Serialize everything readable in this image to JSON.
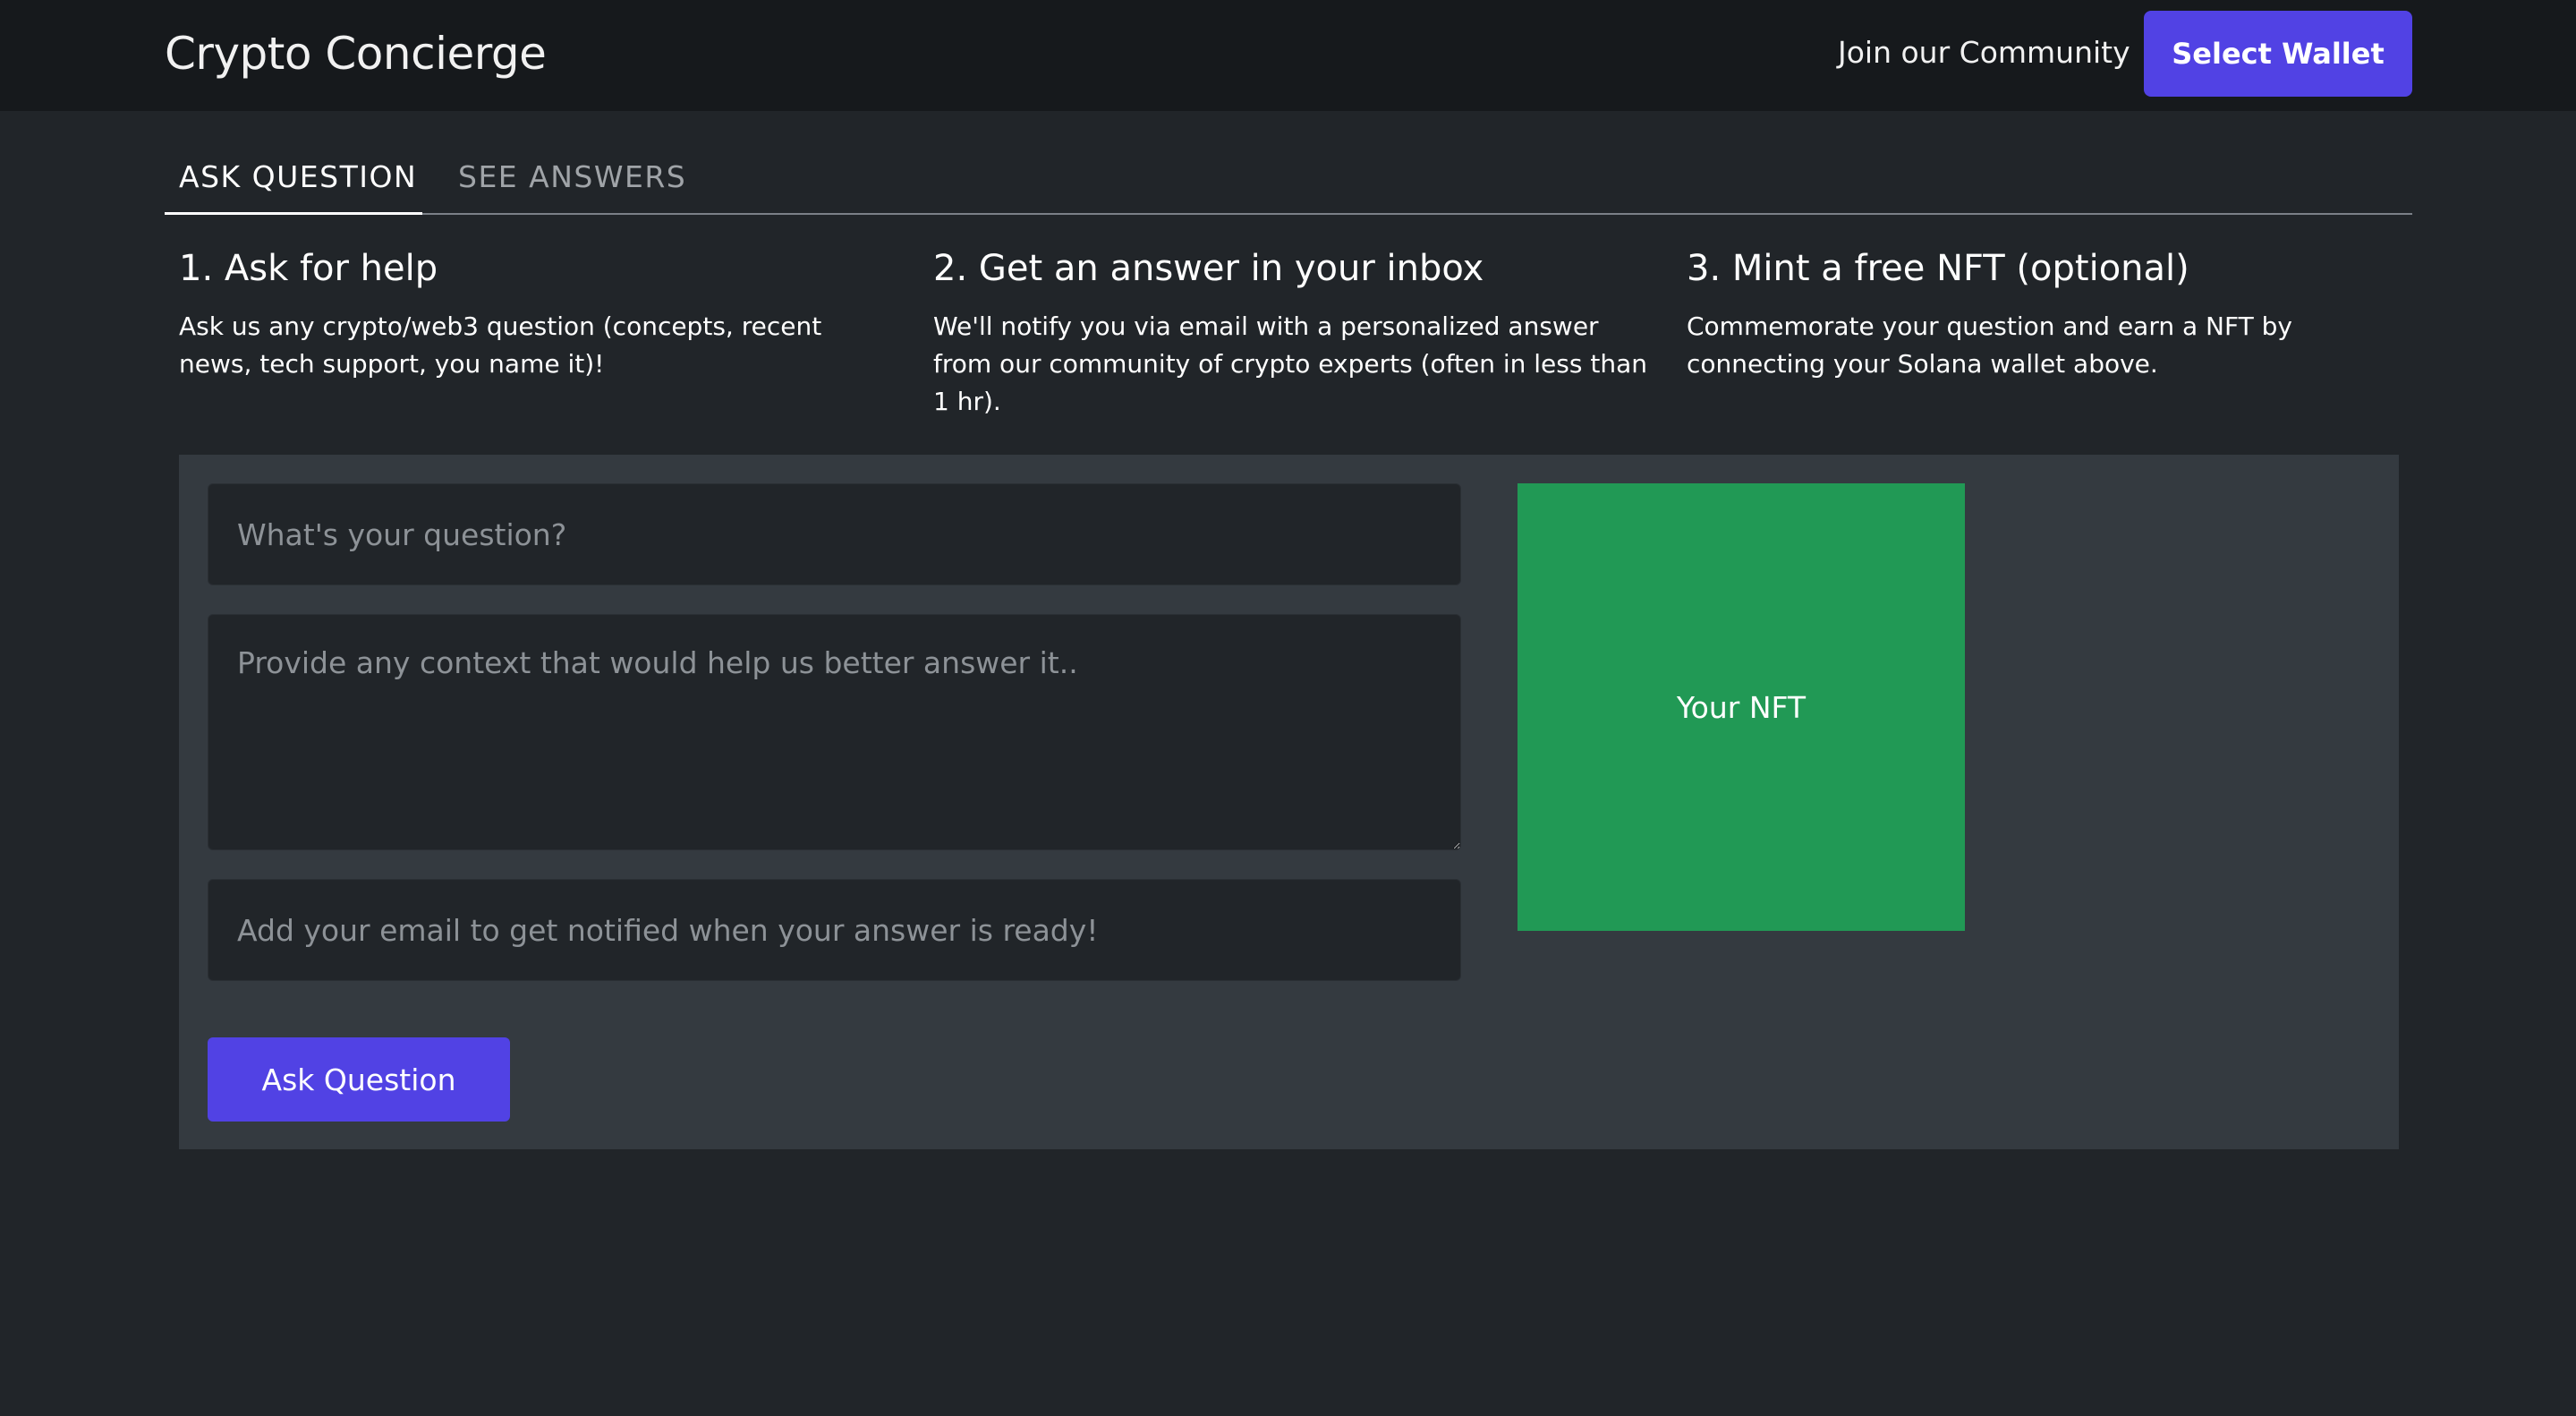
{
  "header": {
    "brand": "Crypto Concierge",
    "community_link": "Join our Community",
    "wallet_button": "Select Wallet"
  },
  "tabs": [
    {
      "label": "ASK QUESTION",
      "active": true
    },
    {
      "label": "SEE ANSWERS",
      "active": false
    }
  ],
  "steps": [
    {
      "title": "1. Ask for help",
      "text": "Ask us any crypto/web3 question (concepts, recent news, tech support, you name it)!"
    },
    {
      "title": "2. Get an answer in your inbox",
      "text": "We'll notify you via email with a personalized answer from our community of crypto experts (often in less than 1 hr)."
    },
    {
      "title": "3. Mint a free NFT (optional)",
      "text": "Commemorate your question and earn a NFT by connecting your Solana wallet above."
    }
  ],
  "form": {
    "question_placeholder": "What's your question?",
    "context_placeholder": "Provide any context that would help us better answer it..",
    "email_placeholder": "Add your email to get notified when your answer is ready!",
    "submit_label": "Ask Question"
  },
  "nft_preview": {
    "label": "Your NFT",
    "color": "#219955"
  },
  "colors": {
    "accent": "#5142e4",
    "background": "#212529",
    "header": "#16191c",
    "panel": "#343a40"
  }
}
